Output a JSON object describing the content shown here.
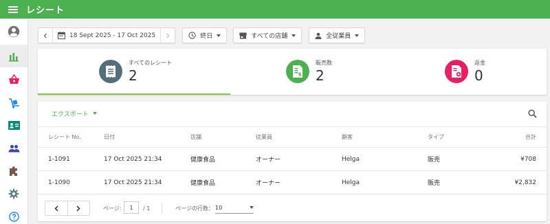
{
  "app": {
    "title": "レシート"
  },
  "sidebar": {
    "items": [
      {
        "icon": "account-circle-icon",
        "active": false
      },
      {
        "icon": "bar-chart-icon",
        "active": true
      },
      {
        "icon": "basket-icon",
        "active": false
      },
      {
        "icon": "dolly-icon",
        "active": false
      },
      {
        "icon": "id-card-icon",
        "active": false
      },
      {
        "icon": "people-icon",
        "active": false
      },
      {
        "icon": "puzzle-icon",
        "active": false
      },
      {
        "icon": "gear-icon",
        "active": false
      },
      {
        "icon": "help-icon",
        "active": false
      }
    ]
  },
  "filters": {
    "date_range": "18 Sept 2025 - 17 Oct 2025",
    "time": "終日",
    "store": "すべての店舗",
    "employee": "全従業員"
  },
  "summary": {
    "all_receipts": {
      "label": "すべてのレシート",
      "value": "2",
      "color": "#546e7a"
    },
    "sales": {
      "label": "販売数",
      "value": "2",
      "color": "#4caf50"
    },
    "refunds": {
      "label": "返金",
      "value": "0",
      "color": "#e91e63"
    }
  },
  "table": {
    "export_label": "エクスポート",
    "columns": [
      "レシート No.",
      "日付",
      "店舗",
      "従業員",
      "顧客",
      "タイプ",
      "合計"
    ],
    "rows": [
      [
        "1-1091",
        "17 Oct 2025 21:34",
        "健康食品",
        "オーナー",
        "Helga",
        "販売",
        "¥708"
      ],
      [
        "1-1090",
        "17 Oct 2025 21:34",
        "健康食品",
        "オーナー",
        "Helga",
        "販売",
        "¥2,832"
      ]
    ]
  },
  "pagination": {
    "page_label": "ページ:",
    "page_value": "1",
    "page_total": "/ 1",
    "rows_label": "ページの行数：",
    "rows_value": "10"
  }
}
